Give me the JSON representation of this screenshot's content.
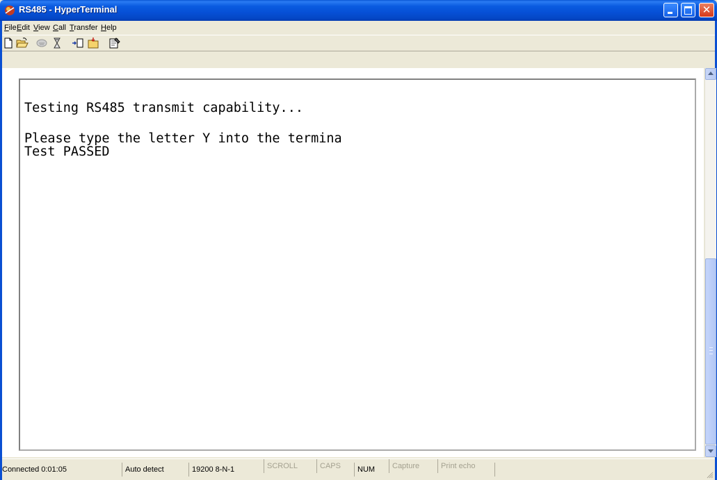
{
  "window": {
    "title": "RS485 - HyperTerminal",
    "icon": "hyperterminal-app-icon"
  },
  "menu": {
    "items": [
      {
        "label": "File",
        "mnemonic": "F"
      },
      {
        "label": "Edit",
        "mnemonic": "E"
      },
      {
        "label": "View",
        "mnemonic": "V"
      },
      {
        "label": "Call",
        "mnemonic": "C"
      },
      {
        "label": "Transfer",
        "mnemonic": "T"
      },
      {
        "label": "Help",
        "mnemonic": "H"
      }
    ]
  },
  "toolbar": {
    "buttons": [
      "new-connection-icon",
      "open-icon",
      "disconnect-phone-icon",
      "connect-phone-icon",
      "send-file-icon",
      "receive-file-icon",
      "properties-icon"
    ]
  },
  "terminal": {
    "lines": [
      "Testing RS485 transmit capability...",
      "",
      "Please type the letter Y into the termina",
      "Test PASSED"
    ]
  },
  "status": {
    "connection": "Connected 0:01:05",
    "emulation": "Auto detect",
    "settings": "19200 8-N-1",
    "scroll": "SCROLL",
    "caps": "CAPS",
    "num": "NUM",
    "capture": "Capture",
    "print_echo": "Print echo"
  },
  "colors": {
    "titlebar": "#0a5be0",
    "window_bg": "#ece9d8",
    "terminal_bg": "#ffffff"
  }
}
